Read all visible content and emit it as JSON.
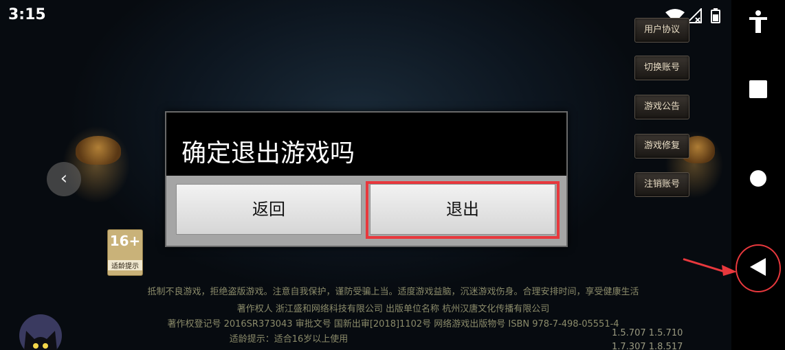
{
  "status_bar": {
    "time": "3:15",
    "icons": [
      "wifi-icon",
      "signal-icon",
      "battery-icon"
    ]
  },
  "side_menu": {
    "items": [
      "用户协议",
      "切换账号",
      "游戏公告",
      "游戏修复",
      "注销账号"
    ]
  },
  "age_badge": {
    "number": "16+",
    "label": "适龄提示"
  },
  "notices": {
    "health_notice": "抵制不良游戏，拒绝盗版游戏。注意自我保护，谨防受骗上当。适度游戏益脑，沉迷游戏伤身。合理安排时间，享受健康生活",
    "copyright_line": "著作权人 浙江盛和网络科技有限公司 出版单位名称 杭州汉唐文化传播有限公司",
    "registration_line": "著作权登记号 2016SR373043 审批文号 国新出审[2018]1102号 网络游戏出版物号 ISBN 978-7-498-05551-4",
    "age_line": "适龄提示：适合16岁以上使用"
  },
  "versions": {
    "line1": "1.5.707  1.5.710",
    "line2": "1.7.307  1.8.517"
  },
  "dialog": {
    "title": "确定退出游戏吗",
    "return_label": "返回",
    "exit_label": "退出"
  },
  "highlight_color": "#e8383d",
  "nav_bar": {
    "icons": [
      "accessibility-icon",
      "recents-icon",
      "home-icon",
      "back-icon"
    ]
  }
}
